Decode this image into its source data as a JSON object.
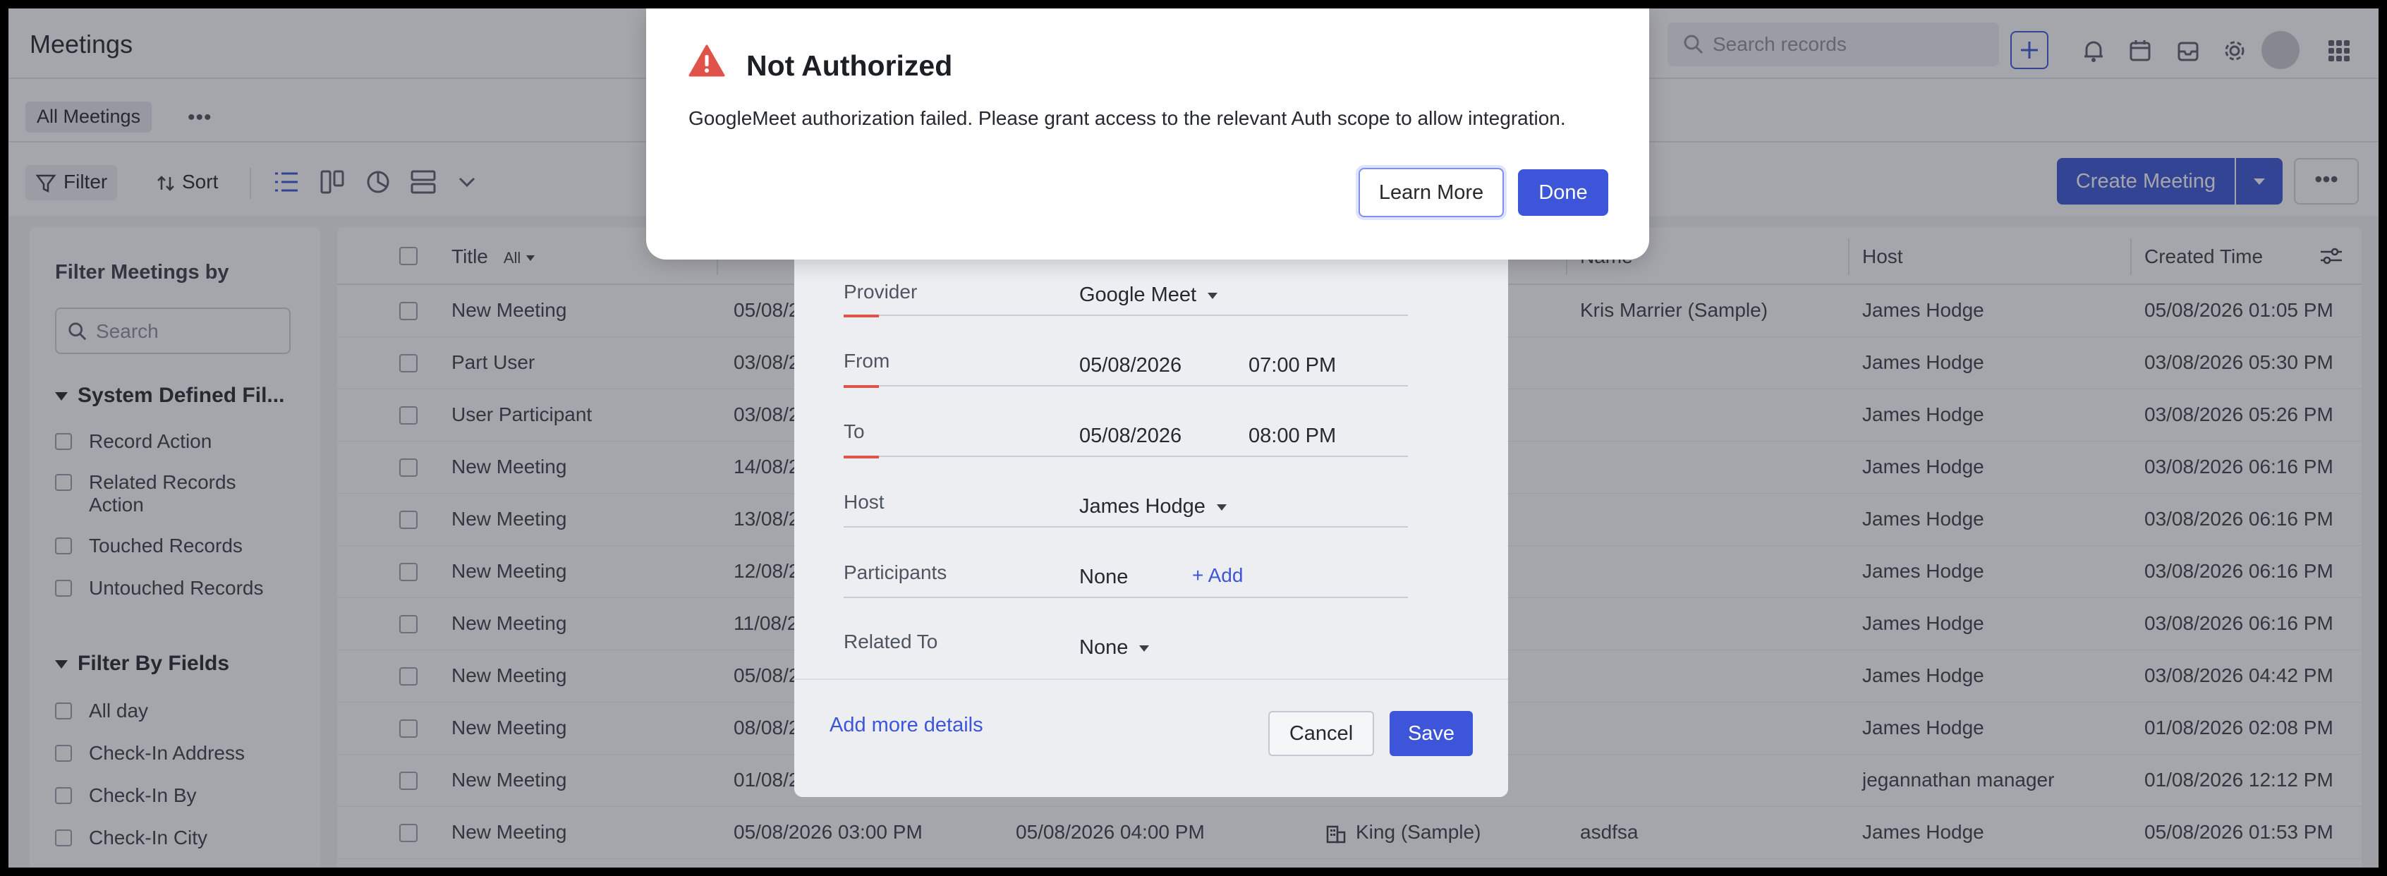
{
  "app": {
    "title": "Meetings"
  },
  "header": {
    "search_placeholder": "Search records"
  },
  "subbar": {
    "view_label": "All Meetings"
  },
  "toolbar": {
    "filter_label": "Filter",
    "sort_label": "Sort",
    "create_label": "Create Meeting"
  },
  "filter_panel": {
    "title": "Filter Meetings by",
    "search_placeholder": "Search",
    "system_section": "System Defined Fil...",
    "system_items": [
      "Record Action",
      "Related Records Action",
      "Touched Records",
      "Untouched Records"
    ],
    "fields_section": "Filter By Fields",
    "field_items": [
      "All day",
      "Check-In Address",
      "Check-In By",
      "Check-In City"
    ]
  },
  "table": {
    "headers": {
      "title": "Title",
      "title_filter": "All",
      "account_name": "Name",
      "host": "Host",
      "created_time": "Created Time"
    },
    "rows": [
      {
        "title": "New Meeting",
        "from": "05/08/2",
        "to": "",
        "related": "",
        "account": "Kris Marrier (Sample)",
        "host": "James Hodge",
        "created": "05/08/2026 01:05 PM"
      },
      {
        "title": "Part User",
        "from": "03/08/2",
        "to": "",
        "related": "",
        "account": "",
        "host": "James Hodge",
        "created": "03/08/2026 05:30 PM"
      },
      {
        "title": "User Participant",
        "from": "03/08/2",
        "to": "",
        "related": "",
        "account": "",
        "host": "James Hodge",
        "created": "03/08/2026 05:26 PM"
      },
      {
        "title": "New Meeting",
        "from": "14/08/2",
        "to": "",
        "related": "",
        "account": "",
        "host": "James Hodge",
        "created": "03/08/2026 06:16 PM"
      },
      {
        "title": "New Meeting",
        "from": "13/08/2",
        "to": "",
        "related": "",
        "account": "",
        "host": "James Hodge",
        "created": "03/08/2026 06:16 PM"
      },
      {
        "title": "New Meeting",
        "from": "12/08/2",
        "to": "",
        "related": "",
        "account": "",
        "host": "James Hodge",
        "created": "03/08/2026 06:16 PM"
      },
      {
        "title": "New Meeting",
        "from": "11/08/2",
        "to": "",
        "related": "",
        "account": "",
        "host": "James Hodge",
        "created": "03/08/2026 06:16 PM"
      },
      {
        "title": "New Meeting",
        "from": "05/08/2",
        "to": "",
        "related": "",
        "account": "",
        "host": "James Hodge",
        "created": "03/08/2026 04:42 PM"
      },
      {
        "title": "New Meeting",
        "from": "08/08/2",
        "to": "",
        "related": "",
        "account": "",
        "host": "James Hodge",
        "created": "01/08/2026 02:08 PM"
      },
      {
        "title": "New Meeting",
        "from": "01/08/2",
        "to": "",
        "related": "",
        "account": "",
        "host": "jegannathan manager",
        "created": "01/08/2026 12:12 PM"
      },
      {
        "title": "New Meeting",
        "from": "05/08/2026 03:00 PM",
        "to": "05/08/2026 04:00 PM",
        "related": "King (Sample)",
        "account": "asdfsa",
        "host": "James Hodge",
        "created": "05/08/2026 01:53 PM"
      }
    ]
  },
  "meeting_form": {
    "provider_label": "Provider",
    "provider_value": "Google Meet",
    "from_label": "From",
    "from_date": "05/08/2026",
    "from_time": "07:00 PM",
    "to_label": "To",
    "to_date": "05/08/2026",
    "to_time": "08:00 PM",
    "host_label": "Host",
    "host_value": "James Hodge",
    "participants_label": "Participants",
    "participants_value": "None",
    "add_label": "+ Add",
    "related_label": "Related To",
    "related_value": "None",
    "more_details": "Add more details",
    "cancel": "Cancel",
    "save": "Save"
  },
  "alert": {
    "title": "Not Authorized",
    "message": "GoogleMeet authorization failed. Please grant access to the relevant Auth scope to allow integration.",
    "learn_more": "Learn More",
    "done": "Done"
  },
  "colors": {
    "accent": "#3d56d9",
    "warning": "#e0534a",
    "overlay": "rgba(40,44,56,0.42)"
  },
  "icons": [
    "search-icon",
    "plus-icon",
    "bell-icon",
    "calendar-icon",
    "inbox-icon",
    "gear-icon",
    "apps-grid-icon",
    "filter-icon",
    "sort-icon",
    "list-view-icon",
    "kanban-view-icon",
    "chart-view-icon",
    "sheet-view-icon",
    "warning-icon"
  ]
}
